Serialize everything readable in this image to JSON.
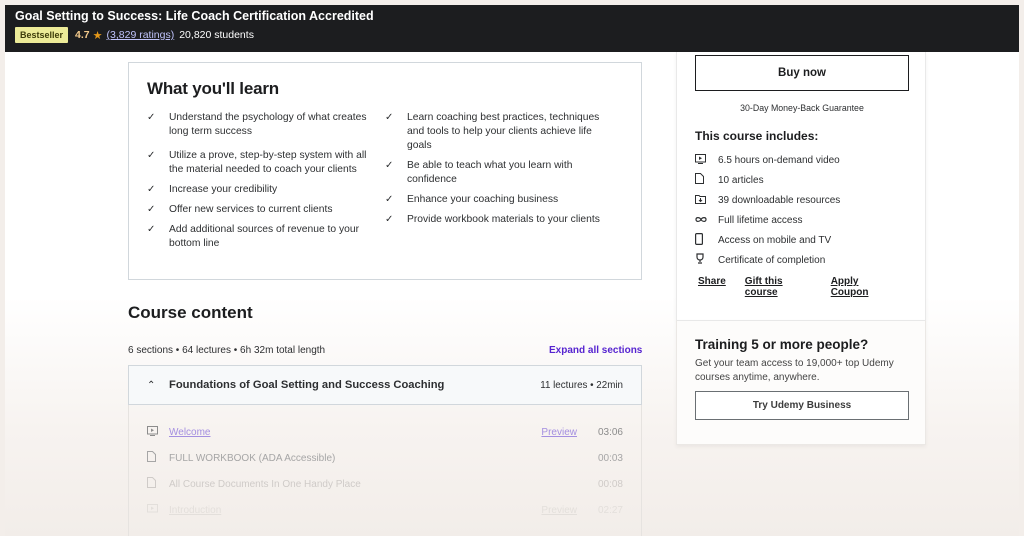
{
  "header": {
    "title": "Goal Setting to Success: Life Coach Certification Accredited",
    "badge": "Bestseller",
    "rating": "4.7",
    "star_icon": "★",
    "ratings_count": "(3,829 ratings)",
    "students": "20,820 students"
  },
  "learn": {
    "title": "What you'll learn",
    "check_icon": "✓",
    "left": [
      "Understand the psychology of what creates long term success",
      "Utilize a prove, step-by-step system with all the material needed to coach your clients",
      "Increase your credibility",
      "Offer new services to current clients",
      "Add additional sources of revenue to your bottom line"
    ],
    "right": [
      "Learn coaching best practices, techniques and tools to help your clients achieve life goals",
      "Be able to teach what you learn with confidence",
      "Enhance your coaching business",
      "Provide workbook materials to your clients"
    ]
  },
  "course_content": {
    "title": "Course content",
    "summary": "6 sections • 64 lectures • 6h 32m total length",
    "expand_label": "Expand all sections",
    "section": {
      "chevron_icon": "⌃",
      "name": "Foundations of Goal Setting and Success Coaching",
      "info": "11 lectures • 22min"
    },
    "lectures": [
      {
        "icon": "video",
        "name": "Welcome",
        "preview": "Preview",
        "duration": "03:06"
      },
      {
        "icon": "article",
        "name": "FULL WORKBOOK (ADA Accessible)",
        "preview": "",
        "duration": "00:03"
      },
      {
        "icon": "article",
        "name": "All Course Documents In One Handy Place",
        "preview": "",
        "duration": "00:08"
      },
      {
        "icon": "video",
        "name": "Introduction",
        "preview": "Preview",
        "duration": "02:27"
      }
    ]
  },
  "sidebar": {
    "buy_label": "Buy now",
    "guarantee": "30-Day Money-Back Guarantee",
    "includes_title": "This course includes:",
    "includes": [
      {
        "icon": "video-icon",
        "text": "6.5 hours on-demand video"
      },
      {
        "icon": "file-icon",
        "text": "10 articles"
      },
      {
        "icon": "download-folder-icon",
        "text": "39 downloadable resources"
      },
      {
        "icon": "infinity-icon",
        "text": "Full lifetime access"
      },
      {
        "icon": "mobile-icon",
        "text": "Access on mobile and TV"
      },
      {
        "icon": "trophy-icon",
        "text": "Certificate of completion"
      }
    ],
    "links": [
      "Share",
      "Gift this course",
      "Apply Coupon"
    ],
    "business": {
      "title": "Training 5 or more people?",
      "text": "Get your team access to 19,000+ top Udemy courses anytime, anywhere.",
      "button": "Try Udemy Business"
    }
  }
}
